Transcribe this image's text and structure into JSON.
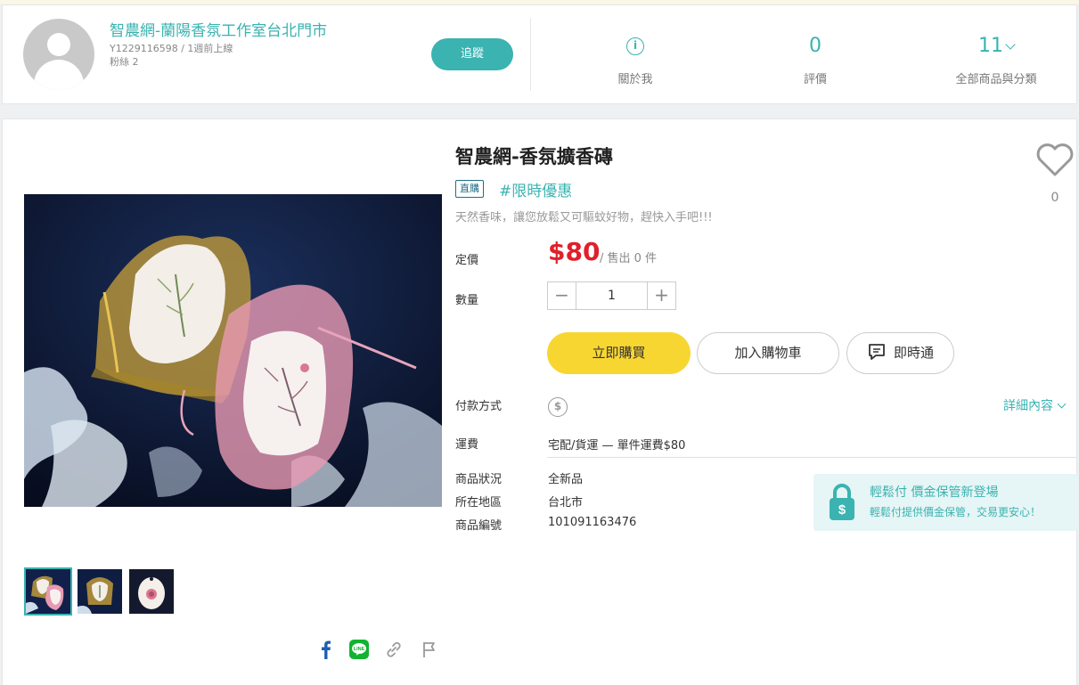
{
  "seller": {
    "name": "智農網-蘭陽香氛工作室台北門市",
    "meta": "Y1229116598 / 1週前上線",
    "fans": "粉絲 2",
    "follow_label": "追蹤",
    "about_label": "關於我",
    "rating_value": "0",
    "rating_label": "評價",
    "products_value": "11",
    "products_label": "全部商品與分類"
  },
  "product": {
    "title": "智農網-香氛擴香磚",
    "badge": "直購",
    "promo_tag": "#限時優惠",
    "description": "天然香味，讓您放鬆又可驅蚊好物，趕快入手吧!!!",
    "like_count": "0",
    "price_label": "定價",
    "price": "$80",
    "sold": "/ 售出 0 件",
    "quantity_label": "數量",
    "quantity": "1",
    "buy_label": "立即購買",
    "cart_label": "加入購物車",
    "chat_label": "即時通",
    "payment_label": "付款方式",
    "detail_link": "詳細內容",
    "shipping_label": "運費",
    "shipping_value": "宅配/貨運 — 單件運費$80",
    "condition_label": "商品狀況",
    "condition_value": "全新品",
    "location_label": "所在地區",
    "location_value": "台北市",
    "id_label": "商品編號",
    "id_value": "101091163476"
  },
  "escrow": {
    "title": "輕鬆付 價金保管新登場",
    "subtitle": "輕鬆付提供價金保管，交易更安心！"
  },
  "colors": {
    "accent": "#3ab3b1",
    "price": "#e0202a",
    "buy_button": "#f8d632"
  },
  "icons": [
    "info-icon",
    "chevron-down-icon",
    "heart-icon",
    "dollar-icon",
    "chat-icon",
    "lock-icon",
    "facebook-icon",
    "line-icon",
    "link-icon",
    "flag-icon"
  ]
}
